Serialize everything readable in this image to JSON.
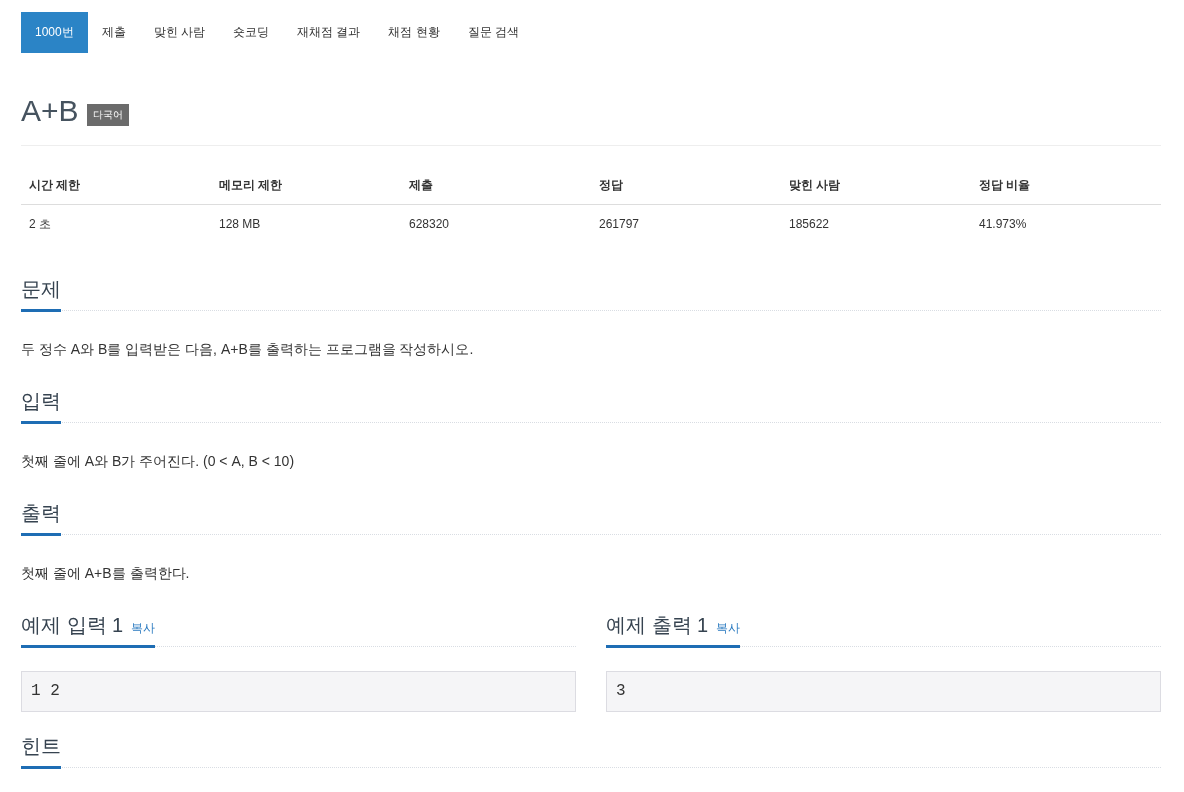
{
  "tabs": [
    {
      "label": "1000번",
      "selected": true
    },
    {
      "label": "제출",
      "selected": false
    },
    {
      "label": "맞힌 사람",
      "selected": false
    },
    {
      "label": "숏코딩",
      "selected": false
    },
    {
      "label": "재채점 결과",
      "selected": false
    },
    {
      "label": "채점 현황",
      "selected": false
    },
    {
      "label": "질문 검색",
      "selected": false
    }
  ],
  "problem": {
    "title": "A+B",
    "badge": "다국어"
  },
  "info_table": {
    "columns": [
      "시간 제한",
      "메모리 제한",
      "제출",
      "정답",
      "맞힌 사람",
      "정답 비율"
    ],
    "rows": [
      [
        "2 초",
        "128 MB",
        "628320",
        "261797",
        "185622",
        "41.973%"
      ]
    ]
  },
  "sections": [
    {
      "heading": "문제",
      "text": "두 정수 A와 B를 입력받은 다음, A+B를 출력하는 프로그램을 작성하시오."
    },
    {
      "heading": "입력",
      "text": "첫째 줄에 A와 B가 주어진다. (0 < A, B < 10)"
    },
    {
      "heading": "출력",
      "text": "첫째 줄에 A+B를 출력한다."
    }
  ],
  "samples": [
    {
      "heading": "예제 입력 1",
      "copy_link": "복사",
      "content": "1 2"
    },
    {
      "heading": "예제 출력 1",
      "copy_link": "복사",
      "content": "3"
    }
  ],
  "hint": {
    "heading": "힌트"
  }
}
